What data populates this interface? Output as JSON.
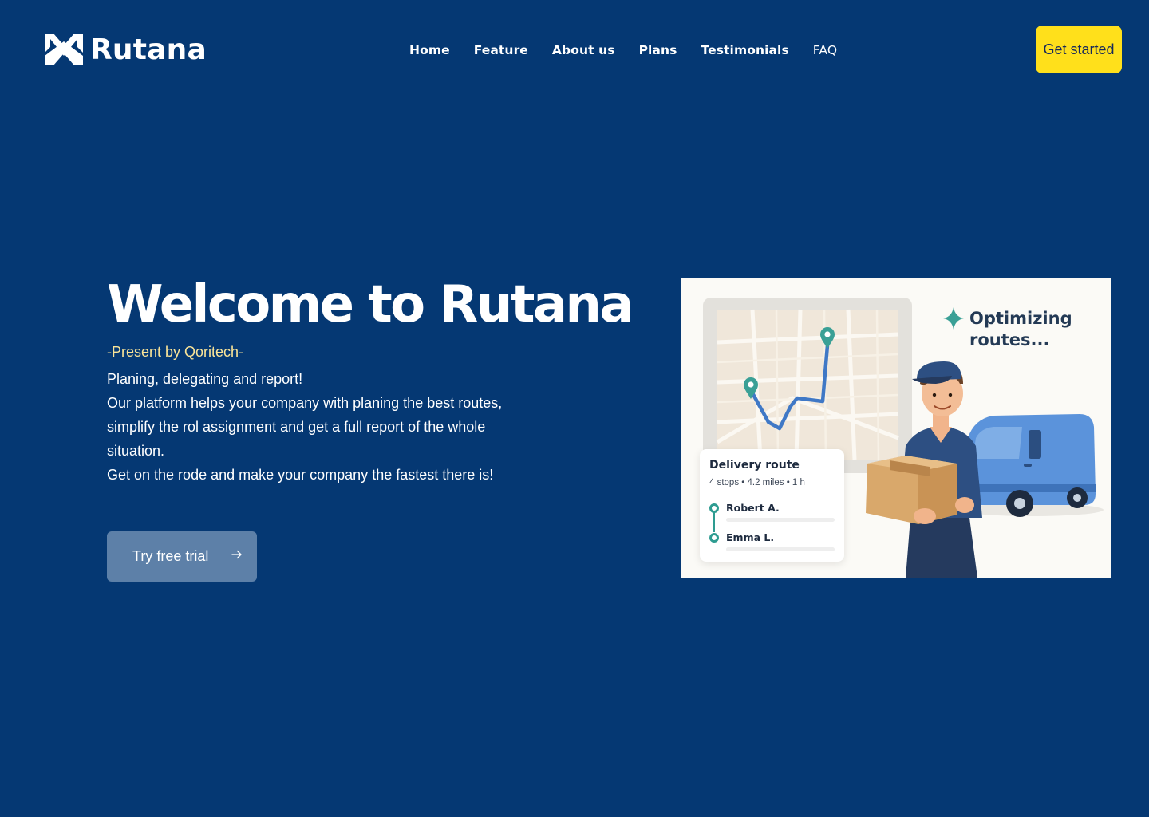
{
  "brand": {
    "name": "Rutana",
    "logo_icon": "rutana-chevron-logo"
  },
  "nav": {
    "items": [
      {
        "label": "Home"
      },
      {
        "label": "Feature"
      },
      {
        "label": "About us"
      },
      {
        "label": "Plans"
      },
      {
        "label": "Testimonials"
      },
      {
        "label": "FAQ"
      }
    ],
    "cta_label": "Get started"
  },
  "hero": {
    "title": "Welcome to Rutana",
    "presenter": "-Present by Qoritech-",
    "description": [
      "Planing, delegating and report!",
      "Our platform helps your company with planing the best routes, simplify the rol assignment and get a full report of the whole situation.",
      "Get on the rode and make your company the fastest there is!"
    ],
    "trial_label": "Try free trial",
    "trial_icon": "arrow-right-icon"
  },
  "illustration": {
    "status_label": "Optimizing routes...",
    "status_icon": "sparkle-icon",
    "route_card": {
      "title": "Delivery route",
      "meta": "4 stops • 4.2 miles • 1 h",
      "stops": [
        {
          "name": "Robert A."
        },
        {
          "name": "Emma L."
        }
      ]
    }
  },
  "colors": {
    "background": "#053873",
    "cta": "#FFE01B",
    "presenter_text": "#FAE498",
    "trial_button": "#5D80A8",
    "route_accent": "#2E9C91",
    "route_path": "#3F78C6"
  }
}
